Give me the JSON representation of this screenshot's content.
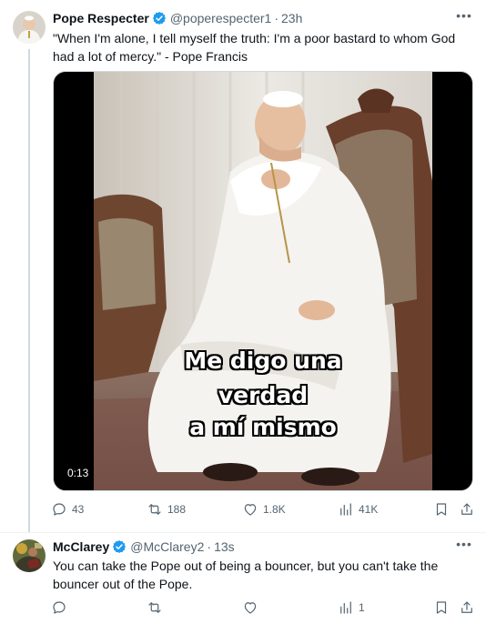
{
  "tweets": [
    {
      "name": "Pope Respecter",
      "handle": "@poperespecter1",
      "separator": "·",
      "time": "23h",
      "more": "•••",
      "text": "\"When I'm alone, I tell myself the truth: I'm a poor bastard to whom God had a lot of mercy.\" - Pope Francis",
      "media": {
        "caption_lines": [
          "Me digo una",
          "verdad",
          "a mí mismo"
        ],
        "duration": "0:13"
      },
      "metrics": {
        "replies": "43",
        "reposts": "188",
        "likes": "1.8K",
        "views": "41K"
      }
    },
    {
      "name": "McClarey",
      "handle": "@McClarey2",
      "separator": "·",
      "time": "13s",
      "more": "•••",
      "text": "You can take the Pope out of being a bouncer, but you can't take the bouncer out of the Pope.",
      "metrics": {
        "views": "1"
      }
    }
  ],
  "colors": {
    "verified_blue": "#1d9bf0",
    "secondary_text": "#536471",
    "thread_line": "#cfd9de"
  },
  "icons": [
    "reply-icon",
    "repost-icon",
    "like-icon",
    "views-icon",
    "bookmark-icon",
    "share-icon",
    "verified-badge-icon",
    "more-icon"
  ]
}
